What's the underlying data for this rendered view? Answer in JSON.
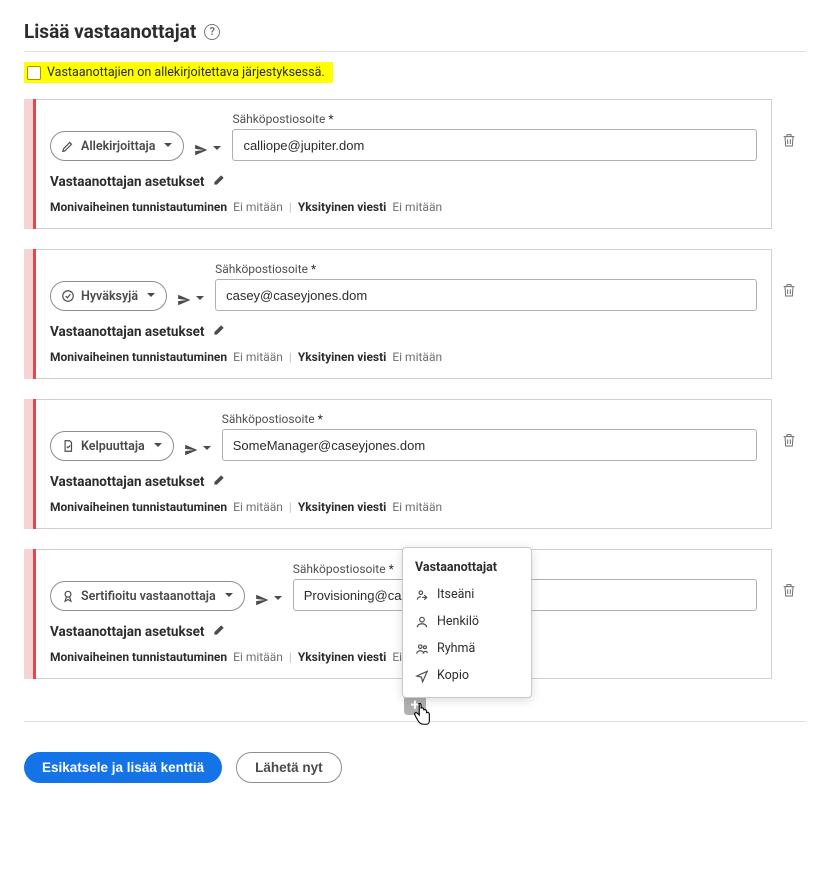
{
  "title": "Lisää vastaanottajat",
  "order_checkbox_label": "Vastaanottajien on allekirjoitettava järjestyksessä.",
  "email_label": "Sähköpostiosoite",
  "required_mark": "*",
  "settings_label": "Vastaanottajan asetukset",
  "mfa_label": "Monivaiheinen tunnistautuminen",
  "mfa_value": "Ei mitään",
  "pm_label": "Yksityinen viesti",
  "pm_value": "Ei mitään",
  "recipients": [
    {
      "role": "Allekirjoittaja",
      "email": "calliope@jupiter.dom"
    },
    {
      "role": "Hyväksyjä",
      "email": "casey@caseyjones.dom"
    },
    {
      "role": "Kelpuuttaja",
      "email": "SomeManager@caseyjones.dom"
    },
    {
      "role": "Sertifioitu vastaanottaja",
      "email": "Provisioning@caseyjones.dom"
    }
  ],
  "popup": {
    "title": "Vastaanottajat",
    "items": [
      "Itseäni",
      "Henkilö",
      "Ryhmä",
      "Kopio"
    ]
  },
  "footer": {
    "primary": "Esikatsele ja lisää kenttiä",
    "secondary": "Lähetä nyt"
  }
}
